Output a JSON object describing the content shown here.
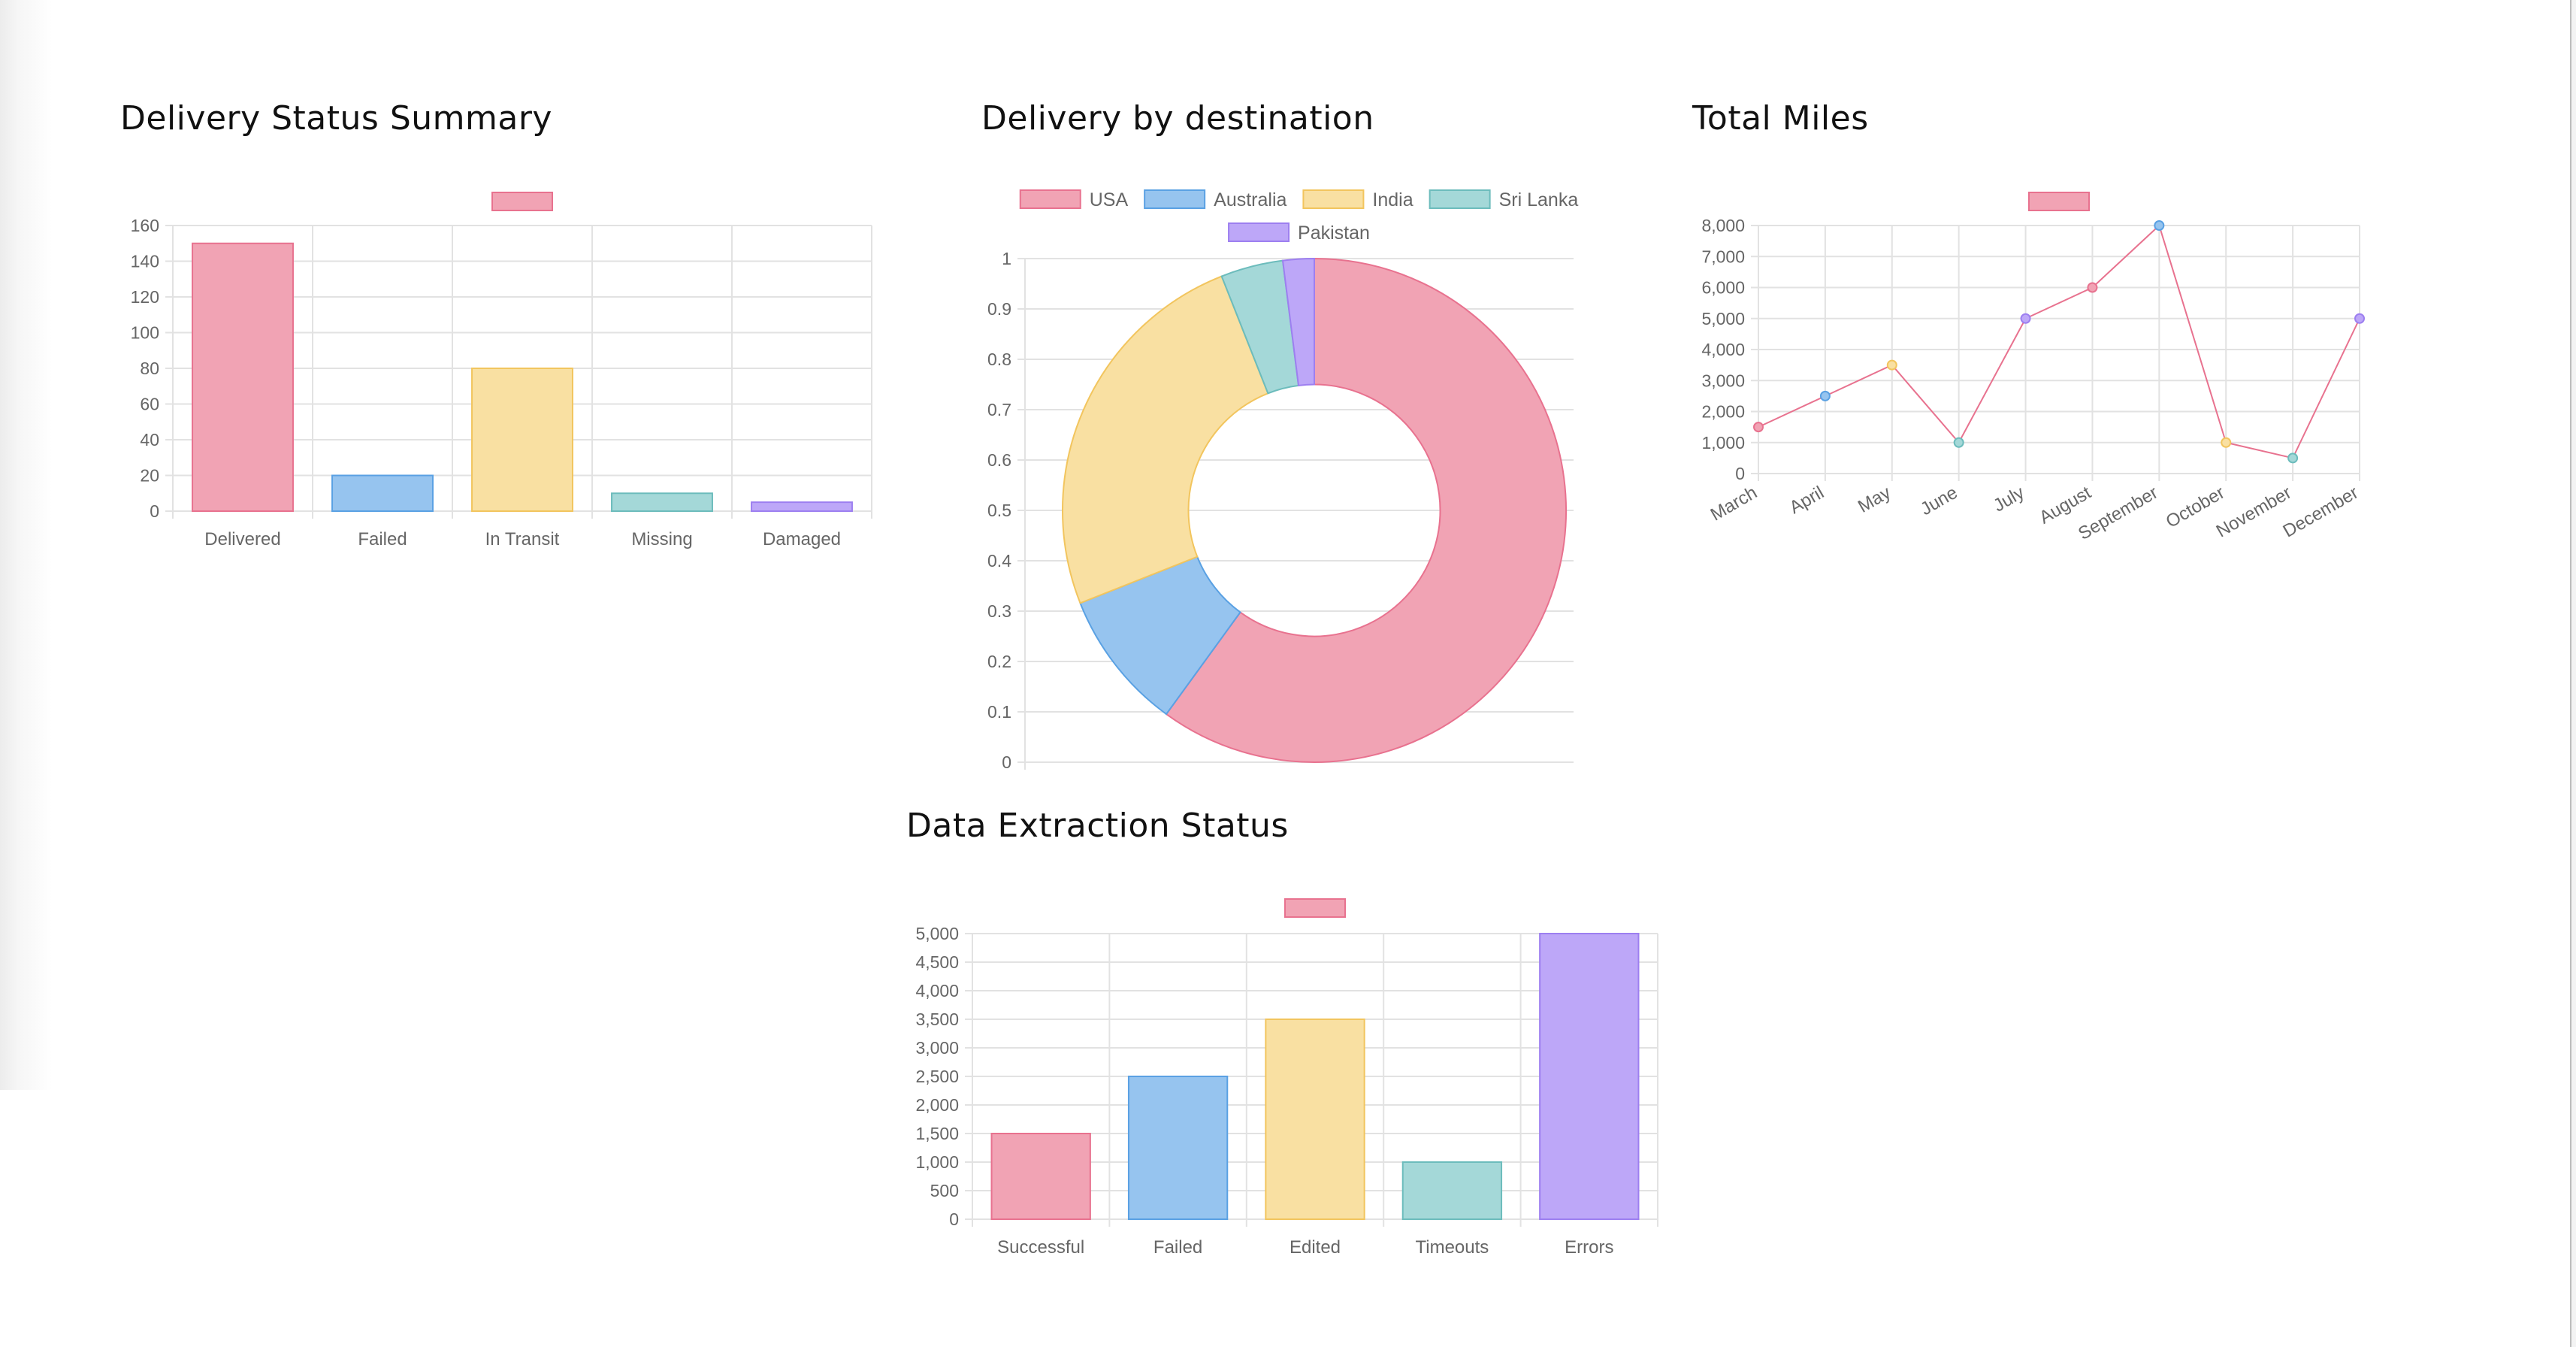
{
  "charts": {
    "delivery_status": {
      "title": "Delivery Status Summary"
    },
    "destination": {
      "title": "Delivery by destination"
    },
    "miles": {
      "title": "Total Miles"
    },
    "extraction": {
      "title": "Data Extraction Status"
    }
  },
  "colors": {
    "bg": [
      "#f1a3b4",
      "#96c4ef",
      "#f9e0a2",
      "#a4d8d8",
      "#bda7f8"
    ],
    "border": [
      "#e8728f",
      "#5aa1e3",
      "#f2c55e",
      "#6cbcbc",
      "#9d7ff0"
    ],
    "line": "#e8728f",
    "grid": "#e2e2e2"
  },
  "chart_data": [
    {
      "id": "delivery_status",
      "type": "bar",
      "title": "Delivery Status Summary",
      "categories": [
        "Delivered",
        "Failed",
        "In Transit",
        "Missing",
        "Damaged"
      ],
      "series": [
        {
          "values": [
            150,
            20,
            80,
            10,
            5
          ]
        }
      ],
      "ylim": [
        0,
        160
      ],
      "yticks": [
        "0",
        "20",
        "40",
        "60",
        "80",
        "100",
        "120",
        "140",
        "160"
      ],
      "grid": true,
      "legend": "top-center"
    },
    {
      "id": "destination",
      "type": "pie",
      "title": "Delivery by destination",
      "labels": [
        "USA",
        "Australia",
        "India",
        "Sri Lanka",
        "Pakistan"
      ],
      "values": [
        60,
        9,
        25,
        4,
        2
      ],
      "yticks": [
        "0",
        "0.1",
        "0.2",
        "0.3",
        "0.4",
        "0.5",
        "0.6",
        "0.7",
        "0.8",
        "0.9",
        "1"
      ],
      "ylim": [
        0,
        1
      ],
      "grid": true,
      "legend": "top-center"
    },
    {
      "id": "miles",
      "type": "line",
      "title": "Total Miles",
      "x": [
        "March",
        "April",
        "May",
        "June",
        "July",
        "August",
        "September",
        "October",
        "November",
        "December"
      ],
      "series": [
        {
          "values": [
            1500,
            2500,
            3500,
            1000,
            5000,
            6000,
            8000,
            1000,
            500,
            5000
          ]
        }
      ],
      "ylim": [
        0,
        8000
      ],
      "yticks": [
        "0",
        "1,000",
        "2,000",
        "3,000",
        "4,000",
        "5,000",
        "6,000",
        "7,000",
        "8,000"
      ],
      "grid": true,
      "legend": "top-center"
    },
    {
      "id": "extraction",
      "type": "bar",
      "title": "Data Extraction Status",
      "categories": [
        "Successful",
        "Failed",
        "Edited",
        "Timeouts",
        "Errors"
      ],
      "series": [
        {
          "values": [
            1500,
            2500,
            3500,
            1000,
            5000
          ]
        }
      ],
      "ylim": [
        0,
        5000
      ],
      "yticks": [
        "0",
        "500",
        "1,000",
        "1,500",
        "2,000",
        "2,500",
        "3,000",
        "3,500",
        "4,000",
        "4,500",
        "5,000"
      ],
      "grid": true,
      "legend": "top-center"
    }
  ]
}
